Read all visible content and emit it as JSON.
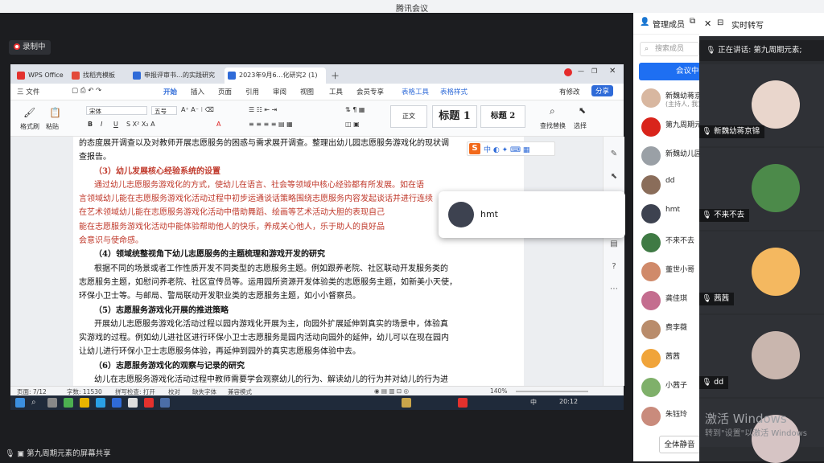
{
  "window": {
    "title": "腾讯会议"
  },
  "share": {
    "record_label": "录制中",
    "sharing_label": "第九周期元素的屏幕共享"
  },
  "wps": {
    "tabs": [
      "WPS Office",
      "找稻壳模板",
      "申报评审书…的实践研究",
      "2023年9月6…化研究2 (1)"
    ],
    "menu": [
      "三 文件",
      "开始",
      "插入",
      "页面",
      "引用",
      "审阅",
      "视图",
      "工具",
      "会员专享",
      "表格工具",
      "表格样式"
    ],
    "right_menu": [
      "有修改",
      "分享"
    ],
    "ribbon": {
      "format_painter": "格式刷",
      "paste": "粘贴",
      "font": "宋体",
      "size": "五号",
      "style_normal": "正文",
      "style_h1": "标题 1",
      "style_h2": "标题 2",
      "find_replace": "查找替换",
      "select": "选择"
    },
    "doc_lines": [
      {
        "t": "的态度展开调查以及对教师开展志愿服务的困惑与需求展开调查。整理出幼儿园志愿服务游戏化的现状调",
        "s": "p"
      },
      {
        "t": "查报告。",
        "s": "p"
      },
      {
        "t": "（3）幼儿发展核心经验系统的设置",
        "s": "redh"
      },
      {
        "t": "通过幼儿志愿服务游戏化的方式，使幼儿在语言、社会等领域中核心经验都有所发展。如在语",
        "s": "redi"
      },
      {
        "t": "言领域幼儿能在志愿服务游戏化活动过程中初步运通谈话策略围绕志愿服务内容发起谈话并进行连续",
        "s": "red"
      },
      {
        "t": "在艺术领域幼儿能在志愿服务游戏化活动中借助舞蹈、绘画等艺术活动大胆的表现自己",
        "s": "red"
      },
      {
        "t": "能在志愿服务游戏化活动中能体验帮助他人的快乐，养成关心他人，乐于助人的良好品",
        "s": "red"
      },
      {
        "t": "会意识与使命感。",
        "s": "red"
      },
      {
        "t": "（4）领域统整视角下幼儿志愿服务的主题梳理和游戏开发的研究",
        "s": "h"
      },
      {
        "t": "根据不同的场景或者工作性质开发不同类型的志愿服务主题。例如跟养老院、社区联动开发服务类的",
        "s": "i"
      },
      {
        "t": "志愿服务主题，如慰问养老院、社区宣传员等。运用园所资源开发体验类的志愿服务主题，如新美小天使，",
        "s": "p"
      },
      {
        "t": "环保小卫士等。与邮局、警局联动开发职业类的志愿服务主题，如小小督察员。",
        "s": "p"
      },
      {
        "t": "（5）志愿服务游戏化开展的推进策略",
        "s": "h"
      },
      {
        "t": "开展幼儿志愿服务游戏化活动过程以园内游戏化开展为主，向园外扩展延伸到真实的场景中，体验真",
        "s": "i"
      },
      {
        "t": "实游戏的过程。例如幼儿进社区进行环保小卫士志愿服务是园内活动向园外的延伸，幼儿可以在现在园内",
        "s": "p"
      },
      {
        "t": "让幼儿进行环保小卫士志愿服务体验，再延伸到园外的真实志愿服务体验中去。",
        "s": "p"
      },
      {
        "t": "（6）志愿服务游戏化的观察与记录的研究",
        "s": "h"
      },
      {
        "t": "幼儿在志愿服务游戏化活动过程中教师需要学会观察幼儿的行为、解读幼儿的行为并对幼儿的行为进",
        "s": "i"
      },
      {
        "t": "行价值判断，记录幼儿在志愿服务游戏化过程中的行为表现。",
        "s": "p"
      }
    ],
    "status": {
      "page": "页面: 7/12",
      "words": "字数: 11530",
      "spell": "拼写检查: 打开",
      "proof": "校对",
      "font_missing": "缺失字体",
      "mode": "兼容模式",
      "zoom": "140%"
    },
    "taskbar": {
      "ime": "中",
      "time": "20:12"
    }
  },
  "ime_popup": {
    "letter": "S",
    "mode": "中"
  },
  "popup": {
    "name": "hmt"
  },
  "members": {
    "header": "管理成员",
    "search_placeholder": "搜索成员",
    "meet_btn": "会议中",
    "list": [
      {
        "name": "新魏幼蒋京",
        "sub": "(主持人, 我)",
        "color": "#d8b7a0"
      },
      {
        "name": "第九周期元",
        "sub": "",
        "color": "#d9241b"
      },
      {
        "name": "新魏幼儿园",
        "sub": "",
        "color": "#9aa0a6"
      },
      {
        "name": "dd",
        "sub": "",
        "color": "#8a6d5a"
      },
      {
        "name": "hmt",
        "sub": "",
        "color": "#3d4250"
      },
      {
        "name": "不来不去",
        "sub": "",
        "color": "#3f7a44"
      },
      {
        "name": "董世小哥",
        "sub": "",
        "color": "#d08a6a"
      },
      {
        "name": "龚佳琪",
        "sub": "",
        "color": "#c46d8f"
      },
      {
        "name": "费李薇",
        "sub": "",
        "color": "#b98c6b"
      },
      {
        "name": "茜茜",
        "sub": "",
        "color": "#f0a43a"
      },
      {
        "name": "小茜子",
        "sub": "",
        "color": "#7fb06a"
      },
      {
        "name": "朱钰玲",
        "sub": "",
        "color": "#c98b7c"
      }
    ],
    "mute_all": "全体静音"
  },
  "videos": {
    "header": "实时转写",
    "speaking": "正在讲话: 第九周期元素;",
    "tiles": [
      {
        "name": "新魏幼蒋京锦",
        "color": "#e9d6cc"
      },
      {
        "name": "不来不去",
        "color": "#4c8a4a"
      },
      {
        "name": "茜茜",
        "color": "#f4b860"
      },
      {
        "name": "dd",
        "color": "#c9b6ae"
      },
      {
        "name": "",
        "color": "#d6c4c4"
      }
    ],
    "watermark": "激活 Windows",
    "watermark_sub": "转到\"设置\"以激活 Windows"
  }
}
